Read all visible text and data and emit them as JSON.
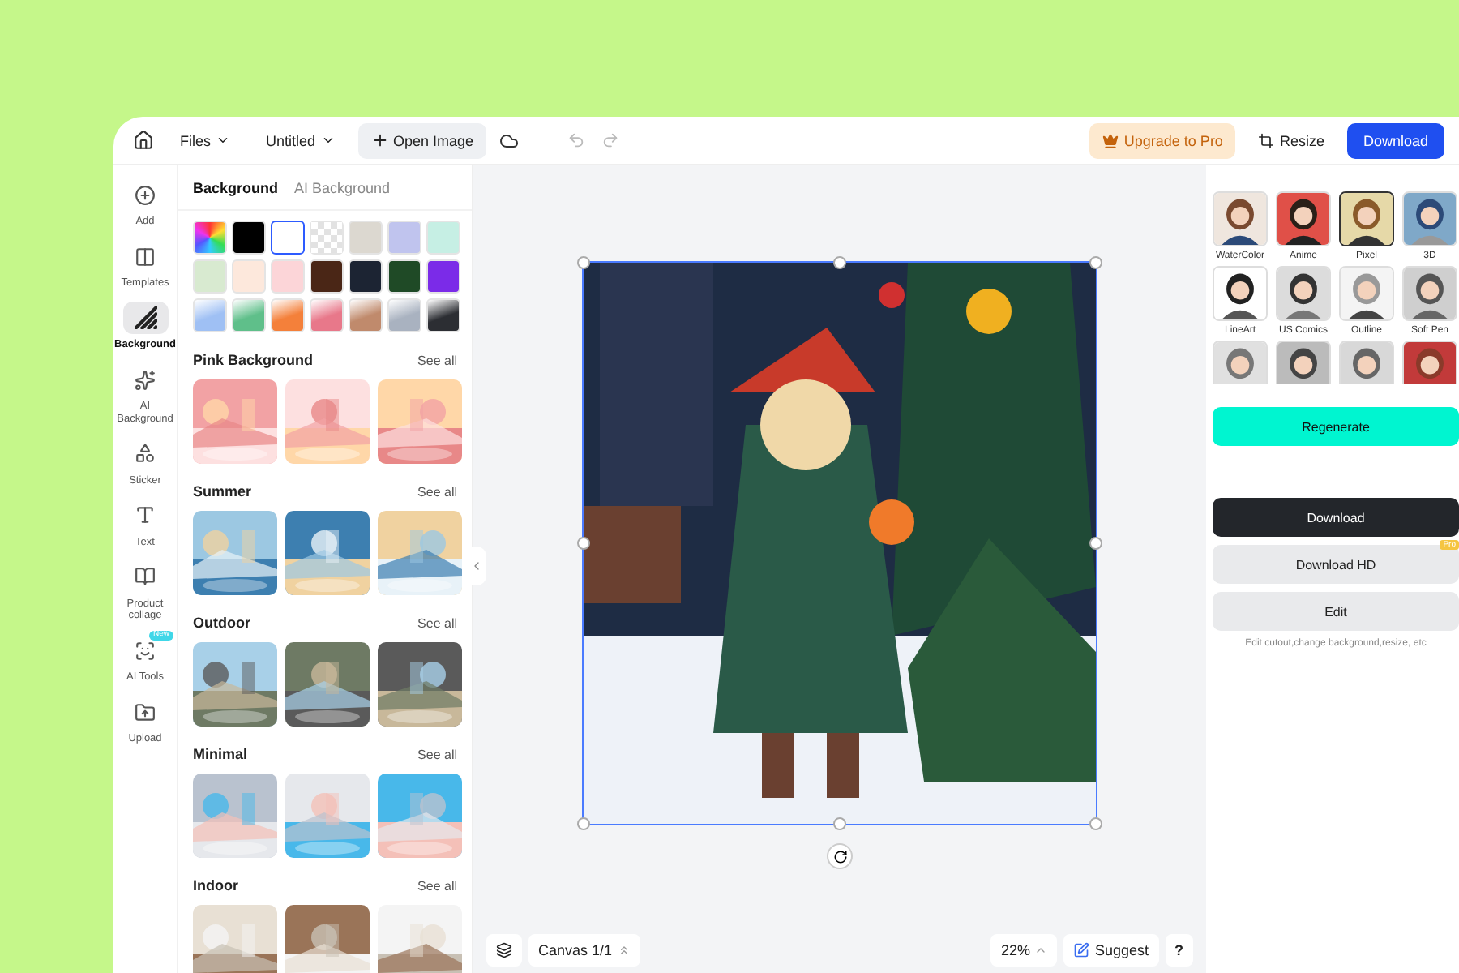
{
  "top_bar": {
    "files": "Files",
    "title": "Untitled",
    "open_image": "Open Image",
    "upgrade": "Upgrade to Pro",
    "resize": "Resize",
    "download": "Download"
  },
  "rail": [
    {
      "label": "Add",
      "selected": false
    },
    {
      "label": "Templates",
      "selected": false
    },
    {
      "label": "Background",
      "selected": true
    },
    {
      "label": "AI Background",
      "selected": false
    },
    {
      "label": "Sticker",
      "selected": false
    },
    {
      "label": "Text",
      "selected": false
    },
    {
      "label": "Product collage",
      "selected": false
    },
    {
      "label": "AI Tools",
      "selected": false,
      "badge": "New"
    },
    {
      "label": "Upload",
      "selected": false
    }
  ],
  "panel": {
    "tabs": [
      {
        "label": "Background",
        "selected": true
      },
      {
        "label": "AI Background",
        "selected": false
      }
    ],
    "swatches": [
      {
        "kind": "rainbow",
        "selected": false
      },
      {
        "kind": "solid",
        "color": "#000000",
        "selected": false
      },
      {
        "kind": "solid",
        "color": "#ffffff",
        "selected": true
      },
      {
        "kind": "transparent",
        "selected": false
      },
      {
        "kind": "solid",
        "color": "#dcd8d0",
        "selected": false
      },
      {
        "kind": "solid",
        "color": "#c0c4ee",
        "selected": false
      },
      {
        "kind": "solid",
        "color": "#c6efe4",
        "selected": false
      },
      {
        "kind": "solid",
        "color": "#d8ead0",
        "selected": false
      },
      {
        "kind": "solid",
        "color": "#fde8dc",
        "selected": false
      },
      {
        "kind": "solid",
        "color": "#fcd5d8",
        "selected": false
      },
      {
        "kind": "solid",
        "color": "#4a2616",
        "selected": false
      },
      {
        "kind": "solid",
        "color": "#1c2433",
        "selected": false
      },
      {
        "kind": "solid",
        "color": "#1f4a26",
        "selected": false
      },
      {
        "kind": "solid",
        "color": "#7b2be8",
        "selected": false
      },
      {
        "kind": "gradient",
        "color": "#9fc0f4",
        "selected": false
      },
      {
        "kind": "gradient",
        "color": "#5fbf8a",
        "selected": false
      },
      {
        "kind": "gradient",
        "color": "#f4803a",
        "selected": false
      },
      {
        "kind": "gradient",
        "color": "#e8788a",
        "selected": false
      },
      {
        "kind": "gradient",
        "color": "#c08a6c",
        "selected": false
      },
      {
        "kind": "gradient",
        "color": "#a9b2c0",
        "selected": false
      },
      {
        "kind": "gradient",
        "color": "#2c2e33",
        "selected": false
      }
    ],
    "sections": [
      {
        "title": "Pink Background",
        "see_all": "See all"
      },
      {
        "title": "Summer",
        "see_all": "See all"
      },
      {
        "title": "Outdoor",
        "see_all": "See all"
      },
      {
        "title": "Minimal",
        "see_all": "See all"
      },
      {
        "title": "Indoor",
        "see_all": "See all"
      }
    ]
  },
  "canvas": {
    "pages": "Canvas 1/1",
    "zoom": "22%",
    "suggest": "Suggest",
    "help": "?"
  },
  "styles": [
    {
      "kind": "style",
      "label": "WaterColor",
      "selected": false
    },
    {
      "kind": "style",
      "label": "Anime",
      "selected": false
    },
    {
      "kind": "style",
      "label": "Pixel",
      "selected": true
    },
    {
      "kind": "style",
      "label": "3D",
      "selected": false
    },
    {
      "kind": "style",
      "label": "LineArt",
      "selected": false
    },
    {
      "kind": "style",
      "label": "US Comics",
      "selected": false
    },
    {
      "kind": "style",
      "label": "Outline",
      "selected": false
    },
    {
      "kind": "style",
      "label": "Soft Pen",
      "selected": false
    },
    {
      "kind": "picture"
    },
    {
      "kind": "picture"
    },
    {
      "kind": "picture"
    },
    {
      "kind": "picture"
    }
  ],
  "actions": {
    "regenerate": "Regenerate",
    "download": "Download",
    "download_hd": "Download HD",
    "pro_badge": "Pro",
    "edit": "Edit",
    "hint": "Edit cutout,change background,resize, etc"
  }
}
